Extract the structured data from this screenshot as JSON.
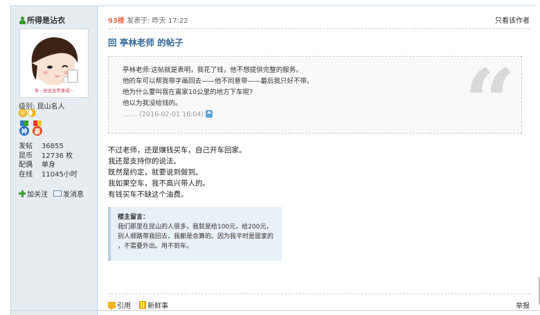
{
  "author": {
    "name": "所得是沾衣",
    "avatar_caption": "来~送送送美像域~",
    "level_label": "级别:",
    "level_value": "昆山名人",
    "medal_1": "神",
    "medal_2": "豪",
    "stats": [
      {
        "key": "发帖",
        "value": "36855"
      },
      {
        "key": "昆币",
        "value": "12736 枚"
      },
      {
        "key": "配偶",
        "value": "单身"
      },
      {
        "key": "在线",
        "value": "11045小时"
      }
    ],
    "follow_label": "加关注",
    "message_label": "发消息"
  },
  "post": {
    "floor": "93楼",
    "posted_at": "发表于: 昨天 17:22",
    "only_author": "只看该作者",
    "title": "回 亭林老师 的帖子",
    "quote_lines": [
      "亭林老师:这帖就是表明，我花了钱，他不想提供完整的服务。",
      "他的车可以帮我带字画回去——他不同意带——最后我只好不带。",
      "他为什么要叫我在离家10公里的地方下车呢?",
      "他以为我没给钱的。"
    ],
    "quote_meta": "....... (2016-02-01 16:04)",
    "body_lines": [
      "不过老师，还是赚钱买车，自己开车回家。",
      "我还是支持你的说法。",
      "既然是约定，就要说到做到。",
      "我如果空车，我不高兴带人的。",
      "有钱买车不缺这个油费。"
    ],
    "note_title": "楼主留言：",
    "note_lines": [
      "我们那里在昆山的人很多，我就是给100元，给200元，",
      "别人顺路带我回去，我都是合算的。因为我平时是居家的",
      "，不需要外出。用不到车。"
    ]
  },
  "footer": {
    "cite_label": "引用",
    "fresh_label": "新鲜事",
    "report_label": "举报"
  }
}
